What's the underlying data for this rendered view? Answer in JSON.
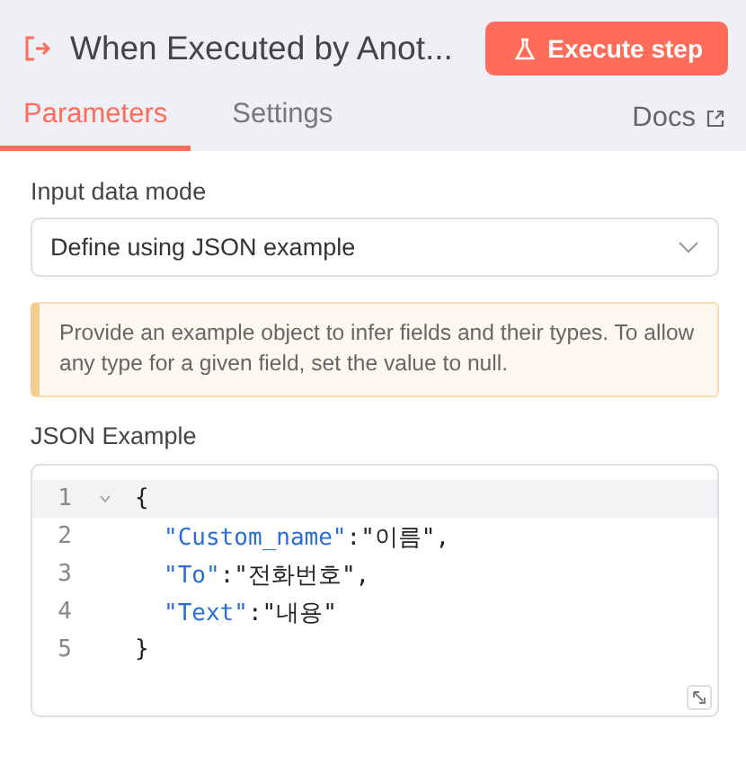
{
  "header": {
    "title": "When Executed by Anot...",
    "action": "Execute step"
  },
  "tabs": [
    {
      "label": "Parameters",
      "selected": true
    },
    {
      "label": "Settings",
      "selected": false
    }
  ],
  "docs_link": "Docs",
  "input_mode": {
    "label": "Input data mode",
    "value": "Define using JSON example"
  },
  "notice": "Provide an example object to infer fields and their types. To allow any type for a given field, set the value to null.",
  "json_example": {
    "label": "JSON Example",
    "lines": [
      {
        "number": "1",
        "active": true,
        "foldable": true,
        "indented": false,
        "segments": [
          {
            "kind": "punct",
            "text": "{"
          }
        ]
      },
      {
        "number": "2",
        "active": false,
        "foldable": false,
        "indented": true,
        "segments": [
          {
            "kind": "key",
            "text": "\"Custom_name\""
          },
          {
            "kind": "punct",
            "text": ":"
          },
          {
            "kind": "string",
            "text": "\"이름\""
          },
          {
            "kind": "punct",
            "text": ","
          }
        ]
      },
      {
        "number": "3",
        "active": false,
        "foldable": false,
        "indented": true,
        "segments": [
          {
            "kind": "key",
            "text": "\"To\""
          },
          {
            "kind": "punct",
            "text": ":"
          },
          {
            "kind": "string",
            "text": "\"전화번호\""
          },
          {
            "kind": "punct",
            "text": ","
          }
        ]
      },
      {
        "number": "4",
        "active": false,
        "foldable": false,
        "indented": true,
        "segments": [
          {
            "kind": "key",
            "text": "\"Text\""
          },
          {
            "kind": "punct",
            "text": ":"
          },
          {
            "kind": "string",
            "text": "\"내용\""
          }
        ]
      },
      {
        "number": "5",
        "active": false,
        "foldable": false,
        "indented": false,
        "segments": [
          {
            "kind": "punct",
            "text": "}"
          }
        ]
      }
    ]
  }
}
